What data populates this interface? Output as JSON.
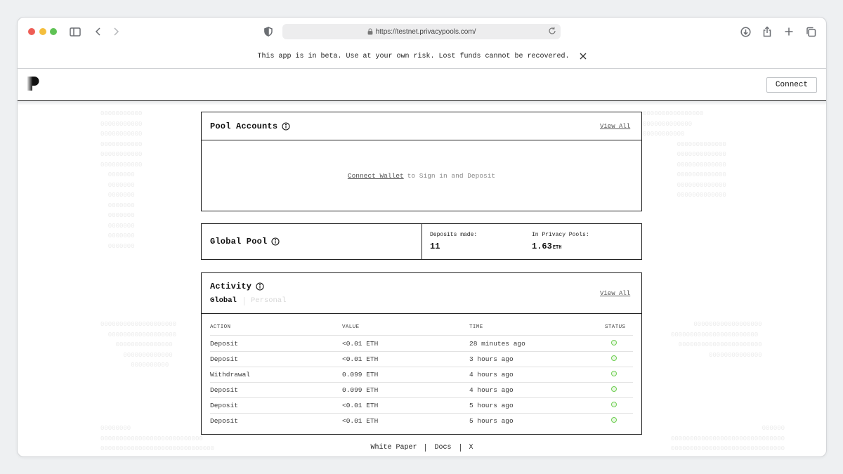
{
  "browser": {
    "url": "https://testnet.privacypools.com/"
  },
  "banner": {
    "text": "This app is in beta. Use at your own risk. Lost funds cannot be recovered."
  },
  "header": {
    "connect_label": "Connect"
  },
  "pool_accounts": {
    "title": "Pool Accounts",
    "view_all": "View All",
    "connect_link": "Connect Wallet",
    "connect_text": "to Sign in and Deposit"
  },
  "global_pool": {
    "title": "Global Pool",
    "deposits_label": "Deposits made:",
    "deposits_value": "11",
    "privacy_label": "In Privacy Pools:",
    "privacy_value": "1.63",
    "privacy_unit": "ETH"
  },
  "activity": {
    "title": "Activity",
    "view_all": "View All",
    "tabs": {
      "global": "Global",
      "personal": "Personal"
    },
    "columns": {
      "action": "ACTION",
      "value": "VALUE",
      "time": "TIME",
      "status": "STATUS"
    },
    "rows": [
      {
        "action": "Deposit",
        "value": "<0.01 ETH",
        "time": "28 minutes ago"
      },
      {
        "action": "Deposit",
        "value": "<0.01 ETH",
        "time": "3 hours ago"
      },
      {
        "action": "Withdrawal",
        "value": "0.099 ETH",
        "time": "4 hours ago"
      },
      {
        "action": "Deposit",
        "value": "0.099 ETH",
        "time": "4 hours ago"
      },
      {
        "action": "Deposit",
        "value": "<0.01 ETH",
        "time": "5 hours ago"
      },
      {
        "action": "Deposit",
        "value": "<0.01 ETH",
        "time": "5 hours ago"
      }
    ]
  },
  "footer": {
    "white_paper": "White Paper",
    "docs": "Docs",
    "x": "X"
  },
  "colors": {
    "status_ok": "#6fcf53",
    "border": "#222222"
  },
  "icons": [
    "sidebar-icon",
    "back-icon",
    "forward-icon",
    "shield-icon",
    "lock-icon",
    "reload-icon",
    "download-icon",
    "share-icon",
    "new-tab-icon",
    "tabs-icon",
    "close-icon",
    "info-icon",
    "status-icon"
  ]
}
